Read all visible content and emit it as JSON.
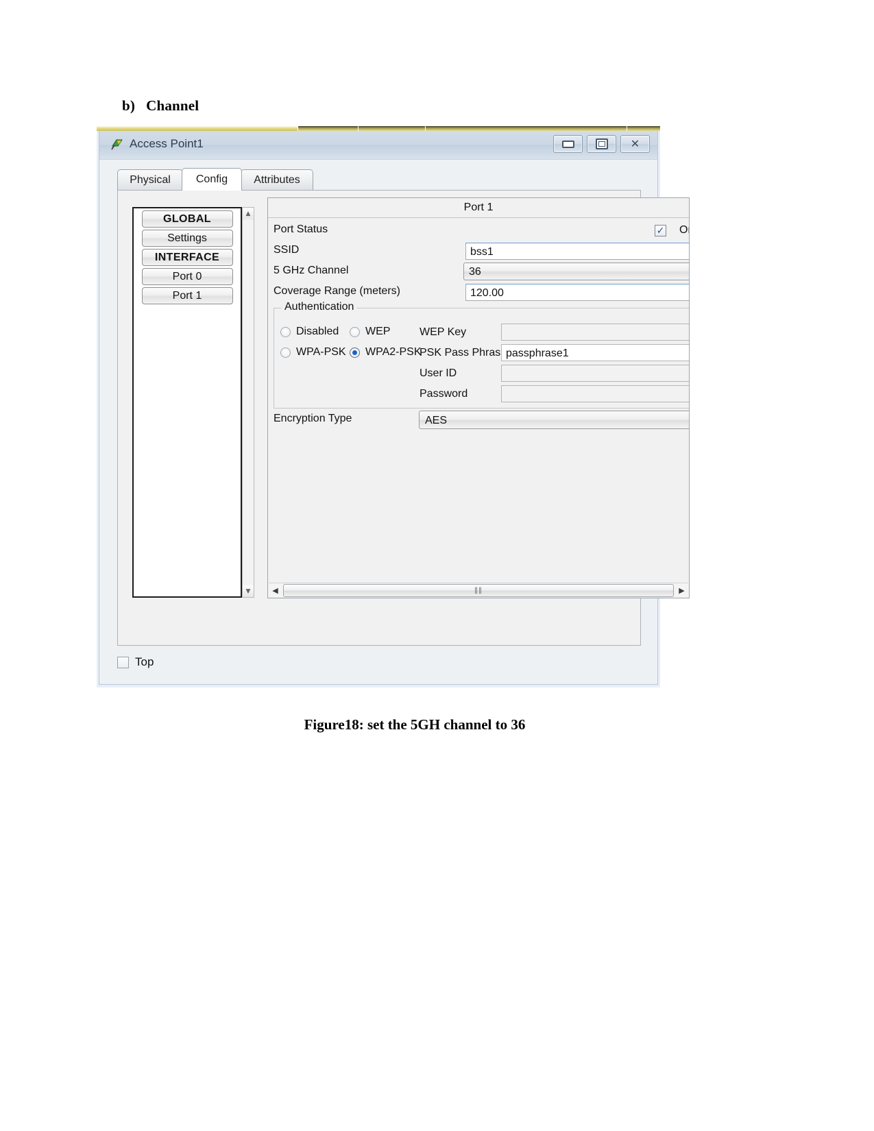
{
  "document": {
    "heading_marker": "b)",
    "heading_text": "Channel",
    "caption": "Figure18: set the 5GH channel to 36"
  },
  "window": {
    "title": "Access Point1",
    "icon": "access-point-icon",
    "buttons": {
      "minimize": "–",
      "maximize": "▣",
      "close": "✕"
    }
  },
  "tabs": [
    {
      "label": "Physical",
      "active": false
    },
    {
      "label": "Config",
      "active": true
    },
    {
      "label": "Attributes",
      "active": false
    }
  ],
  "sidebar": {
    "items": [
      {
        "label": "GLOBAL",
        "bold": true
      },
      {
        "label": "Settings",
        "bold": false
      },
      {
        "label": "INTERFACE",
        "bold": true
      },
      {
        "label": "Port 0",
        "bold": false
      },
      {
        "label": "Port 1",
        "bold": false
      }
    ],
    "scroll_up": "▲",
    "scroll_down": "▼"
  },
  "config": {
    "panel_title": "Port 1",
    "port_status": {
      "label": "Port Status",
      "checked": true,
      "check_glyph": "✓",
      "on_label": "On"
    },
    "ssid": {
      "label": "SSID",
      "value": "bss1"
    },
    "channel": {
      "label": "5 GHz Channel",
      "value": "36"
    },
    "coverage": {
      "label": "Coverage Range (meters)",
      "value": "120.00"
    },
    "authentication": {
      "legend": "Authentication",
      "options": [
        {
          "label": "Disabled",
          "selected": false
        },
        {
          "label": "WEP",
          "selected": false
        },
        {
          "label": "WPA-PSK",
          "selected": false
        },
        {
          "label": "WPA2-PSK",
          "selected": true
        }
      ],
      "fields": [
        {
          "label": "WEP Key",
          "value": "",
          "disabled": true
        },
        {
          "label": "PSK Pass Phrase",
          "value": "passphrase1",
          "disabled": false
        },
        {
          "label": "User ID",
          "value": "",
          "disabled": true
        },
        {
          "label": "Password",
          "value": "",
          "disabled": true
        }
      ]
    },
    "encryption": {
      "label": "Encryption Type",
      "value": "AES"
    },
    "hscroll": {
      "left_arrow": "◀",
      "right_arrow": "▶",
      "grip": "‖‖"
    }
  },
  "footer": {
    "top_checkbox_label": "Top",
    "top_checked": false
  }
}
